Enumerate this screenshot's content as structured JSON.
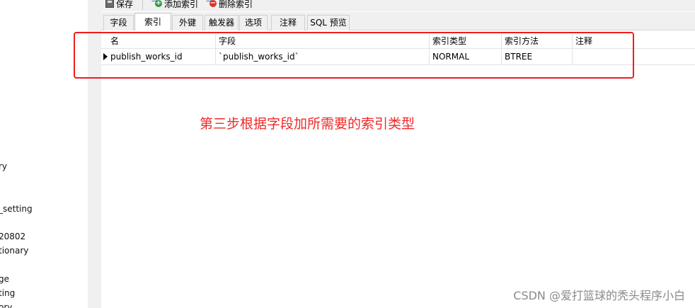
{
  "left_nav": {
    "items": [
      "ry",
      "",
      "_setting",
      "20802",
      "tionary",
      "ge",
      "ting",
      "ory"
    ]
  },
  "toolbar": {
    "save_label": "保存",
    "add_index_label": "添加索引",
    "delete_index_label": "删除索引"
  },
  "tabs": [
    {
      "label": "字段",
      "active": false
    },
    {
      "label": "索引",
      "active": true
    },
    {
      "label": "外键",
      "active": false
    },
    {
      "label": "触发器",
      "active": false
    },
    {
      "label": "选项",
      "active": false
    },
    {
      "label": "注释",
      "active": false
    },
    {
      "label": "SQL 预览",
      "active": false
    }
  ],
  "grid": {
    "columns": [
      "名",
      "字段",
      "索引类型",
      "索引方法",
      "注释"
    ],
    "rows": [
      {
        "name": "publish_works_id",
        "field": "`publish_works_id`",
        "index_type": "NORMAL",
        "index_method": "BTREE",
        "comment": ""
      }
    ]
  },
  "annotation": "第三步根据字段加所需要的索引类型",
  "watermark": "CSDN @爱打篮球的秃头程序小白",
  "colors": {
    "annotation": "#f02828",
    "highlight_box": "#f01c1c",
    "panel_bg": "#f0f0f0"
  }
}
